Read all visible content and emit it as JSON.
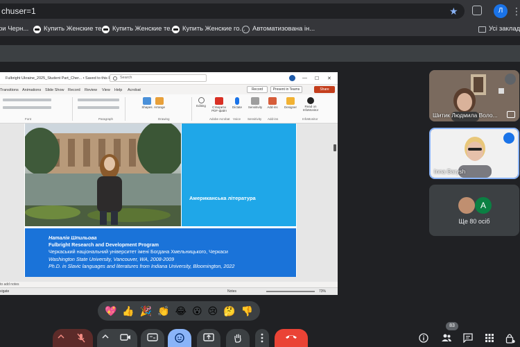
{
  "browser": {
    "url_fragment": "chuser=1",
    "profile_initial": "Л",
    "bookmarks": [
      {
        "label": "ри Черн..."
      },
      {
        "label": "Купить Женские те..."
      },
      {
        "label": "Купить Женские те..."
      },
      {
        "label": "Купить Женские го..."
      },
      {
        "label": "Автоматизована ін..."
      }
    ],
    "all_bookmarks_label": "Усі закладки"
  },
  "ppt": {
    "filename": "Fulbright Ukraine_2025_Student Part_Cher... • Saved to this PC",
    "search_placeholder": "Search",
    "menu": [
      "Transitions",
      "Animations",
      "Slide Show",
      "Record",
      "Review",
      "View",
      "Help",
      "Acrobat"
    ],
    "record_label": "Record",
    "present_label": "Present in Teams",
    "share_label": "Share",
    "ribbon": {
      "shapes": "Shapes",
      "arrange": "Arrange",
      "editing": "Editing",
      "pdf": "Створити PDF-файл",
      "dictate": "Dictate",
      "sensitivity": "Sensitivity",
      "addins": "Add-ins",
      "designer": "Designer",
      "readoninfo": "Read on InfoMonitor",
      "groups": {
        "font": "Font",
        "paragraph": "Paragraph",
        "drawing": "Drawing",
        "acrobat": "Adobe Acrobat",
        "voice": "Voice",
        "sens": "Sensitivity",
        "addins": "Add-ins",
        "info": "InfoMonitor"
      }
    },
    "slide": {
      "panel_title": "Американська література",
      "name": "Наталія Шпильова",
      "program": "Fulbright Research and Development Program",
      "university": "Черкаський національний університет імені Богдана Хмельницького, Черкаси",
      "edu1": "Washington State University, Vancouver, WA, 2008-2009",
      "edu2": "Ph.D. in Slavic languages and literatures from Indiana University, Bloomington, 2022"
    },
    "notes_label": "to add notes",
    "status_left": "vigate",
    "status_notes": "Notes",
    "zoom_label": "73%"
  },
  "participants": [
    {
      "name": "Шитик Людмила Воло..."
    },
    {
      "name": "Inna Barysh"
    }
  ],
  "more_participants": {
    "label": "Ще 80 осіб",
    "avatar_initial": "A"
  },
  "participant_count": "83",
  "reactions": [
    "💖",
    "👍",
    "🎉",
    "👏",
    "😂",
    "😮",
    "😢",
    "🤔",
    "👎"
  ],
  "colors": {
    "meet_bg": "#202124",
    "hangup": "#ea4335",
    "slide_cyan": "#1fa7e8",
    "slide_blue": "#1a73d9"
  }
}
